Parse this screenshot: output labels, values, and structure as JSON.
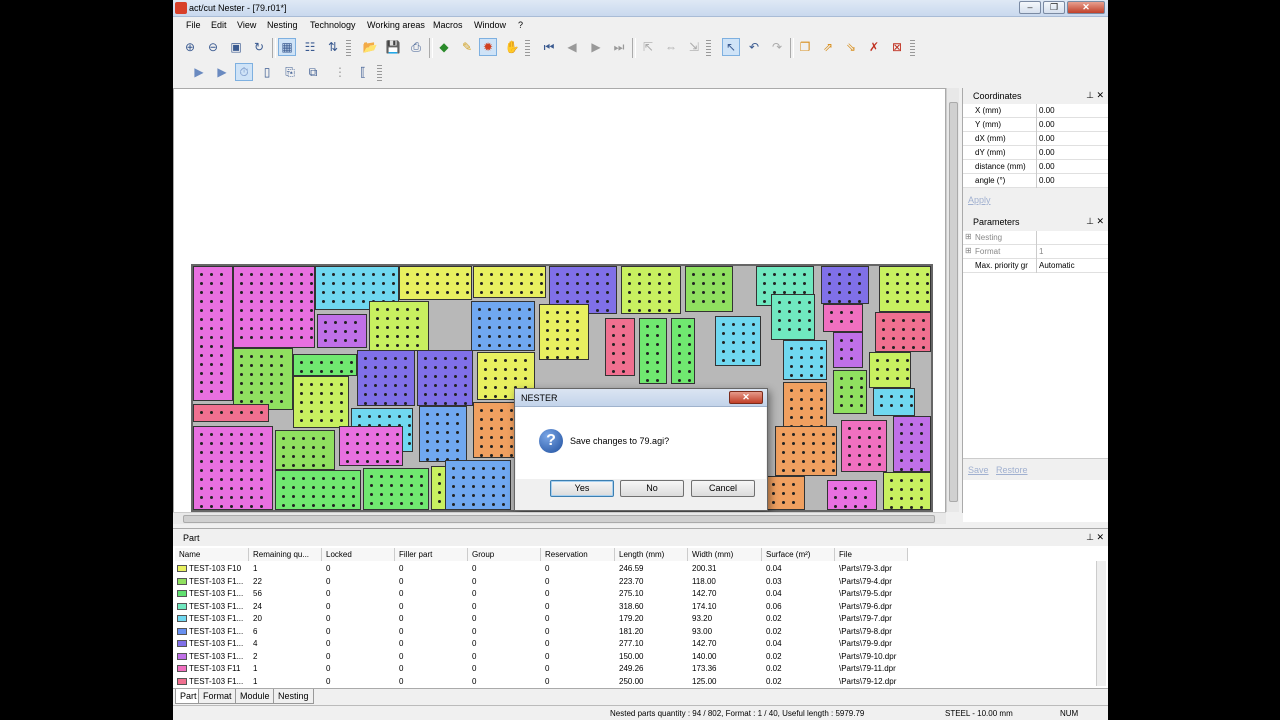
{
  "window": {
    "title": "act/cut Nester - [79.r01*]"
  },
  "menu": [
    "File",
    "Edit",
    "View",
    "Nesting",
    "Technology",
    "Working areas",
    "Macros",
    "Window",
    "?"
  ],
  "dialog": {
    "title": "NESTER",
    "message": "Save changes to 79.agi?",
    "buttons": {
      "yes": "Yes",
      "no": "No",
      "cancel": "Cancel"
    }
  },
  "coordinates": {
    "title": "Coordinates",
    "rows": [
      {
        "label": "X (mm)",
        "value": "0.00"
      },
      {
        "label": "Y (mm)",
        "value": "0.00"
      },
      {
        "label": "dX (mm)",
        "value": "0.00"
      },
      {
        "label": "dY (mm)",
        "value": "0.00"
      },
      {
        "label": "distance (mm)",
        "value": "0.00"
      },
      {
        "label": "angle (°)",
        "value": "0.00"
      }
    ],
    "apply_label": "Apply"
  },
  "parameters": {
    "title": "Parameters",
    "rows": [
      {
        "label": "Nesting",
        "value": ""
      },
      {
        "label": "Format",
        "value": "1"
      },
      {
        "label": "Max. priority gr",
        "value": "Automatic"
      }
    ],
    "save_label": "Save",
    "restore_label": "Restore"
  },
  "part_panel": {
    "title": "Part",
    "columns": [
      "Name",
      "Remaining qu...",
      "Locked",
      "Filler part",
      "Group",
      "Reservation",
      "Length (mm)",
      "Width (mm)",
      "Surface (m²)",
      "File"
    ],
    "rows": [
      {
        "name": "TEST-103 F10",
        "remaining": "1",
        "locked": "0",
        "filler": "0",
        "group": "0",
        "reservation": "0",
        "length": "246.59",
        "width": "200.31",
        "surface": "0.04",
        "file": "\\Parts\\79-3.dpr",
        "color": "#e8f060"
      },
      {
        "name": "TEST-103 F1...",
        "remaining": "22",
        "locked": "0",
        "filler": "0",
        "group": "0",
        "reservation": "0",
        "length": "223.70",
        "width": "118.00",
        "surface": "0.03",
        "file": "\\Parts\\79-4.dpr",
        "color": "#90e060"
      },
      {
        "name": "TEST-103 F1...",
        "remaining": "56",
        "locked": "0",
        "filler": "0",
        "group": "0",
        "reservation": "0",
        "length": "275.10",
        "width": "142.70",
        "surface": "0.04",
        "file": "\\Parts\\79-5.dpr",
        "color": "#60e070"
      },
      {
        "name": "TEST-103 F1...",
        "remaining": "24",
        "locked": "0",
        "filler": "0",
        "group": "0",
        "reservation": "0",
        "length": "318.60",
        "width": "174.10",
        "surface": "0.06",
        "file": "\\Parts\\79-6.dpr",
        "color": "#70e8c0"
      },
      {
        "name": "TEST-103 F1...",
        "remaining": "20",
        "locked": "0",
        "filler": "0",
        "group": "0",
        "reservation": "0",
        "length": "179.20",
        "width": "93.20",
        "surface": "0.02",
        "file": "\\Parts\\79-7.dpr",
        "color": "#70d8f0"
      },
      {
        "name": "TEST-103 F1...",
        "remaining": "6",
        "locked": "0",
        "filler": "0",
        "group": "0",
        "reservation": "0",
        "length": "181.20",
        "width": "93.00",
        "surface": "0.02",
        "file": "\\Parts\\79-8.dpr",
        "color": "#6890f0"
      },
      {
        "name": "TEST-103 F1...",
        "remaining": "4",
        "locked": "0",
        "filler": "0",
        "group": "0",
        "reservation": "0",
        "length": "277.10",
        "width": "142.70",
        "surface": "0.04",
        "file": "\\Parts\\79-9.dpr",
        "color": "#8070e8"
      },
      {
        "name": "TEST-103 F1...",
        "remaining": "2",
        "locked": "0",
        "filler": "0",
        "group": "0",
        "reservation": "0",
        "length": "150.00",
        "width": "140.00",
        "surface": "0.02",
        "file": "\\Parts\\79-10.dpr",
        "color": "#c070e8"
      },
      {
        "name": "TEST-103 F11",
        "remaining": "1",
        "locked": "0",
        "filler": "0",
        "group": "0",
        "reservation": "0",
        "length": "249.26",
        "width": "173.36",
        "surface": "0.02",
        "file": "\\Parts\\79-11.dpr",
        "color": "#f070c0"
      },
      {
        "name": "TEST-103 F1...",
        "remaining": "1",
        "locked": "0",
        "filler": "0",
        "group": "0",
        "reservation": "0",
        "length": "250.00",
        "width": "125.00",
        "surface": "0.02",
        "file": "\\Parts\\79-12.dpr",
        "color": "#f07090"
      }
    ]
  },
  "bottom_tabs": [
    "Part",
    "Format",
    "Module",
    "Nesting"
  ],
  "status": {
    "nested": "Nested parts quantity : 94 / 802, Format : 1 / 40, Useful length : 5979.79",
    "material": "STEEL - 10.00 mm",
    "num": "NUM"
  },
  "toolbar_icons": [
    "zoom-in-icon",
    "zoom-out-icon",
    "zoom-fit-icon",
    "refresh-icon",
    "grid-icon",
    "tree-icon",
    "sort-icon",
    "open-icon",
    "save-icon",
    "print-icon",
    "nest-icon",
    "edit-part-icon",
    "auto-nest-icon",
    "manual-nest-icon",
    "first-icon",
    "prev-icon",
    "next-icon",
    "last-icon",
    "move-icon",
    "select-icon",
    "undo-icon",
    "redo-icon",
    "copy-icon",
    "export-icon",
    "import-icon",
    "delete-icon",
    "close-part-icon"
  ]
}
